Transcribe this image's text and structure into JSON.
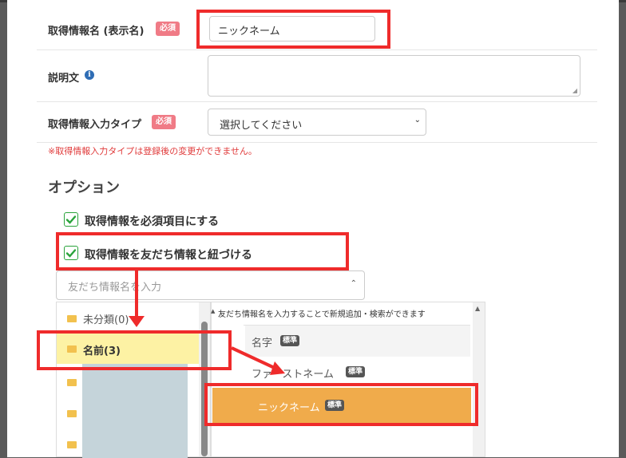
{
  "form": {
    "name_label": "取得情報名 (表示名)",
    "required_badge": "必須",
    "name_value": "ニックネーム",
    "description_label": "説明文",
    "info_icon": "info-icon",
    "input_type_label": "取得情報入力タイプ",
    "input_type_select": "選択してください",
    "input_type_warning": "※取得情報入力タイプは登録後の変更ができません。"
  },
  "options": {
    "title": "オプション",
    "required_check": "取得情報を必須項目にする",
    "link_check": "取得情報を友だち情報と紐づける",
    "search_placeholder": "友だち情報名を入力"
  },
  "folders": [
    {
      "label": "未分類(0)",
      "selected": false
    },
    {
      "label": "名前(3)",
      "selected": true
    }
  ],
  "fields": {
    "hint": "友だち情報名を入力することで新規追加・検索ができます",
    "items": [
      {
        "label": "名字",
        "tag": "標準",
        "selected": false
      },
      {
        "label": "ファーストネーム",
        "tag": "標準",
        "selected": false
      },
      {
        "label": "ニックネーム",
        "tag": "標準",
        "selected": true
      }
    ]
  },
  "colors": {
    "highlight": "#ef2b2b",
    "selected_folder": "#fdf2a4",
    "selected_field": "#f0ab4b",
    "required_badge": "#f07b86",
    "check": "#2aa33b"
  }
}
